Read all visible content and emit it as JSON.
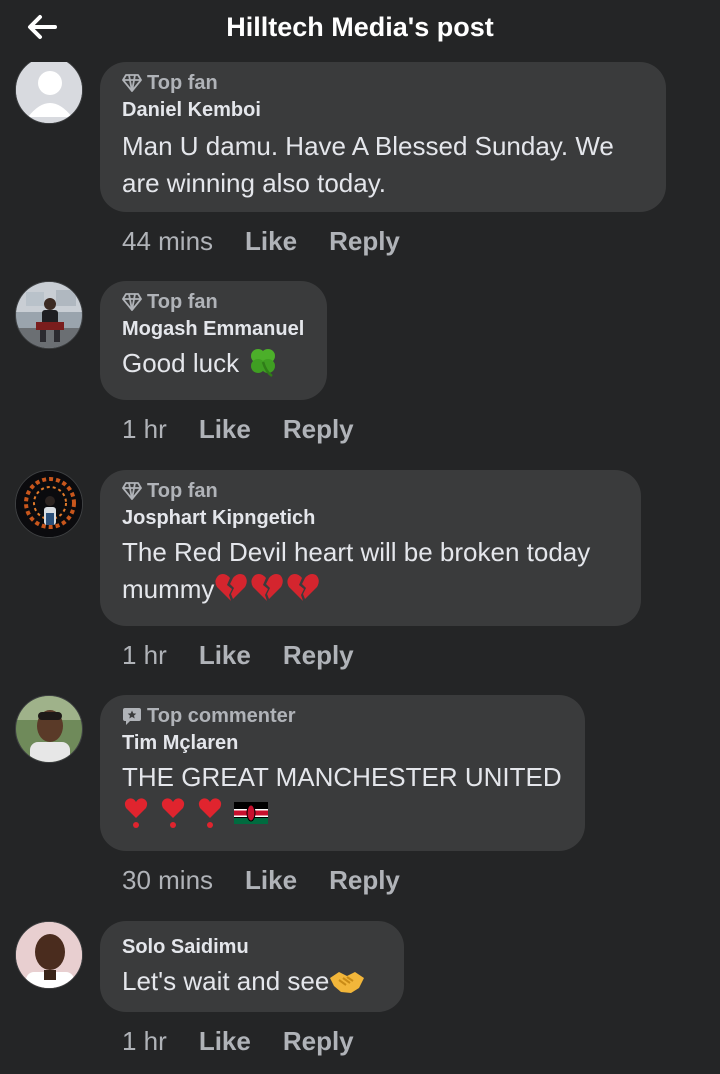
{
  "header": {
    "title": "Hilltech Media's post",
    "back_icon": "arrow-left-icon"
  },
  "comments": [
    {
      "badge": "Top fan",
      "badge_icon": "diamond-icon",
      "author": "Daniel Kemboi",
      "text": "Man U damu. Have A Blessed Sunday. We are winning also today.",
      "time": "44 mins",
      "like": "Like",
      "reply": "Reply",
      "avatar": "default-avatar"
    },
    {
      "badge": "Top fan",
      "badge_icon": "diamond-icon",
      "author": "Mogash Emmanuel",
      "text": "Good luck",
      "emoji": [
        "four-leaf-clover"
      ],
      "time": "1 hr",
      "like": "Like",
      "reply": "Reply",
      "avatar": "photo-avatar"
    },
    {
      "badge": "Top fan",
      "badge_icon": "diamond-icon",
      "author": "Josphart Kipngetich",
      "text_line1": "The Red Devil heart will be broken today",
      "text_line2": "mummy",
      "emoji": [
        "broken-heart",
        "broken-heart",
        "broken-heart"
      ],
      "time": "1 hr",
      "like": "Like",
      "reply": "Reply",
      "avatar": "photo-avatar"
    },
    {
      "badge": "Top commenter",
      "badge_icon": "comment-star-icon",
      "author": "Tim Mçlaren",
      "text": "THE GREAT MANCHESTER UNITED",
      "emoji": [
        "heart-exclamation",
        "heart-exclamation",
        "heart-exclamation",
        "kenya-flag"
      ],
      "time": "30 mins",
      "like": "Like",
      "reply": "Reply",
      "avatar": "photo-avatar"
    },
    {
      "author": "Solo Saidimu",
      "text": "Let's wait and see",
      "emoji": [
        "handshake"
      ],
      "time": "1 hr",
      "like": "Like",
      "reply": "Reply",
      "avatar": "photo-avatar"
    }
  ],
  "colors": {
    "background": "#242526",
    "bubble": "#3a3b3c",
    "text_primary": "#e4e6eb",
    "text_secondary": "#b0b3b8"
  }
}
